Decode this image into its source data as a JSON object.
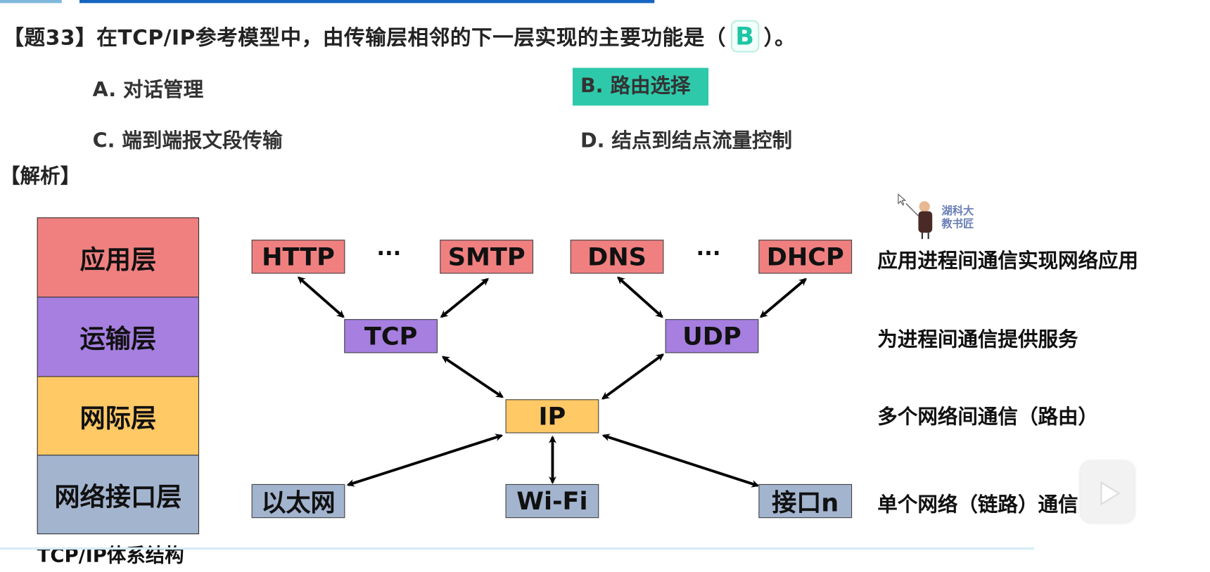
{
  "question": {
    "prefix": "【题33】在TCP/IP参考模型中，由传输层相邻的下一层实现的主要功能是（",
    "answer": "B",
    "suffix": "）。",
    "options": {
      "A": "A. 对话管理",
      "B": "B. 路由选择",
      "C": "C. 端到端报文段传输",
      "D": "D. 结点到结点流量控制"
    },
    "highlight_color": "#2ec9aa"
  },
  "analysis_label": "【解析】",
  "layers": [
    "应用层",
    "运输层",
    "网际层",
    "网络接口层"
  ],
  "layer_colors": [
    "#f08080",
    "#a67fe0",
    "#ffc966",
    "#a3b4cf"
  ],
  "caption": "TCP/IP体系结构",
  "protocols": {
    "app": [
      "HTTP",
      "SMTP",
      "DNS",
      "DHCP"
    ],
    "ellipsis": "···",
    "transport": [
      "TCP",
      "UDP"
    ],
    "internet": "IP",
    "link": [
      "以太网",
      "Wi-Fi",
      "接口n"
    ]
  },
  "descriptions": [
    "应用进程间通信实现网络应用",
    "为进程间通信提供服务",
    "多个网络间通信（路由）",
    "单个网络（链路）通信"
  ],
  "watermark": {
    "text": "湖科大教书匠",
    "line1": "湖科大",
    "line2": "教书匠"
  }
}
